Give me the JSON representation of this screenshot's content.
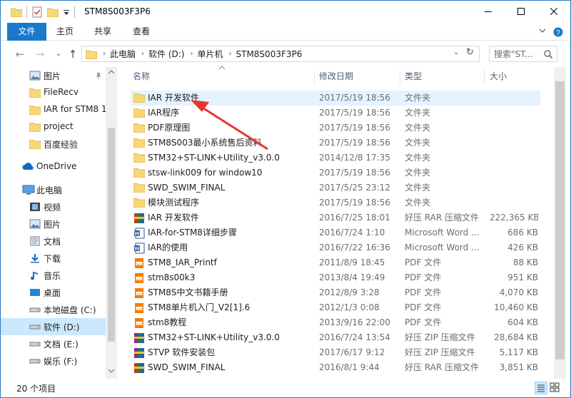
{
  "window": {
    "title": "STM8S003F3P6"
  },
  "ribbon": {
    "tabs": [
      "文件",
      "主页",
      "共享",
      "查看"
    ]
  },
  "address": {
    "crumbs": [
      "此电脑",
      "软件 (D:)",
      "单片机",
      "STM8S003F3P6"
    ],
    "search_placeholder": "搜索\"ST..."
  },
  "columns": {
    "name": "名称",
    "date": "修改日期",
    "type": "类型",
    "size": "大小"
  },
  "nav": {
    "items": [
      {
        "label": "图片",
        "icon": "pictures-icon",
        "pinned": true
      },
      {
        "label": "FileRecv",
        "icon": "folder-icon"
      },
      {
        "label": "IAR for STM8 1",
        "icon": "folder-icon"
      },
      {
        "label": "project",
        "icon": "folder-icon"
      },
      {
        "label": "百度经验",
        "icon": "folder-icon"
      },
      {
        "label": "OneDrive",
        "icon": "onedrive-icon"
      },
      {
        "label": "此电脑",
        "icon": "this-pc-icon"
      },
      {
        "label": "视频",
        "icon": "videos-icon"
      },
      {
        "label": "图片",
        "icon": "pictures-icon"
      },
      {
        "label": "文档",
        "icon": "documents-icon"
      },
      {
        "label": "下载",
        "icon": "downloads-icon"
      },
      {
        "label": "音乐",
        "icon": "music-icon"
      },
      {
        "label": "桌面",
        "icon": "desktop-icon"
      },
      {
        "label": "本地磁盘 (C:)",
        "icon": "drive-icon"
      },
      {
        "label": "软件 (D:)",
        "icon": "drive-icon",
        "selected": true
      },
      {
        "label": "文档 (E:)",
        "icon": "drive-icon"
      },
      {
        "label": "娱乐 (F:)",
        "icon": "drive-icon"
      }
    ]
  },
  "files": [
    {
      "name": "IAR 开发软件",
      "date": "2017/5/19 18:56",
      "type": "文件夹",
      "size": "",
      "icon": "folder-icon"
    },
    {
      "name": "IAR程序",
      "date": "2017/5/19 18:56",
      "type": "文件夹",
      "size": "",
      "icon": "folder-icon"
    },
    {
      "name": "PDF原理图",
      "date": "2017/5/19 18:56",
      "type": "文件夹",
      "size": "",
      "icon": "folder-icon"
    },
    {
      "name": "STM8S003最小系统售后资料",
      "date": "2017/5/19 18:56",
      "type": "文件夹",
      "size": "",
      "icon": "folder-icon"
    },
    {
      "name": "STM32+ST-LINK+Utility_v3.0.0",
      "date": "2014/12/8 17:35",
      "type": "文件夹",
      "size": "",
      "icon": "folder-icon"
    },
    {
      "name": "stsw-link009 for window10",
      "date": "2017/5/19 18:56",
      "type": "文件夹",
      "size": "",
      "icon": "folder-icon"
    },
    {
      "name": "SWD_SWIM_FINAL",
      "date": "2017/5/25 23:12",
      "type": "文件夹",
      "size": "",
      "icon": "folder-icon"
    },
    {
      "name": "模块测试程序",
      "date": "2017/5/19 18:56",
      "type": "文件夹",
      "size": "",
      "icon": "folder-icon"
    },
    {
      "name": "IAR 开发软件",
      "date": "2016/7/25 18:01",
      "type": "好压 RAR 压缩文件",
      "size": "222,365 KB",
      "icon": "rar-archive-icon"
    },
    {
      "name": "IAR-for-STM8详细步骤",
      "date": "2016/7/24 1:10",
      "type": "Microsoft Word ...",
      "size": "686 KB",
      "icon": "word-document-icon"
    },
    {
      "name": "IAR的使用",
      "date": "2016/7/22 16:36",
      "type": "Microsoft Word ...",
      "size": "426 KB",
      "icon": "word-document-icon"
    },
    {
      "name": "STM8_IAR_Printf",
      "date": "2011/8/9 18:45",
      "type": "PDF 文件",
      "size": "88 KB",
      "icon": "pdf-file-icon"
    },
    {
      "name": "stm8s00k3",
      "date": "2013/8/4 19:49",
      "type": "PDF 文件",
      "size": "951 KB",
      "icon": "pdf-file-icon"
    },
    {
      "name": "STM8S中文书籍手册",
      "date": "2012/8/9 3:28",
      "type": "PDF 文件",
      "size": "4,070 KB",
      "icon": "pdf-file-icon"
    },
    {
      "name": "STM8单片机入门_V2[1].6",
      "date": "2012/1/3 0:08",
      "type": "PDF 文件",
      "size": "10,460 KB",
      "icon": "pdf-file-icon"
    },
    {
      "name": "stm8教程",
      "date": "2013/9/16 22:00",
      "type": "PDF 文件",
      "size": "604 KB",
      "icon": "pdf-file-icon"
    },
    {
      "name": "STM32+ST-LINK+Utility_v3.0.0",
      "date": "2016/7/24 13:54",
      "type": "好压 ZIP 压缩文件",
      "size": "28,684 KB",
      "icon": "zip-archive-icon"
    },
    {
      "name": "STVP 软件安装包",
      "date": "2017/6/17 9:12",
      "type": "好压 ZIP 压缩文件",
      "size": "5,117 KB",
      "icon": "zip-archive-icon"
    },
    {
      "name": "SWD_SWIM_FINAL",
      "date": "2016/8/1 9:44",
      "type": "好压 RAR 压缩文件",
      "size": "3,851 KB",
      "icon": "rar-archive-icon"
    }
  ],
  "status": {
    "count": "20 个项目"
  },
  "colors": {
    "accent": "#1979ca",
    "selection": "#cce8ff",
    "hover_row": "#e5f3ff",
    "folder": "#f8d775",
    "annotation_arrow": "#e8362f"
  }
}
